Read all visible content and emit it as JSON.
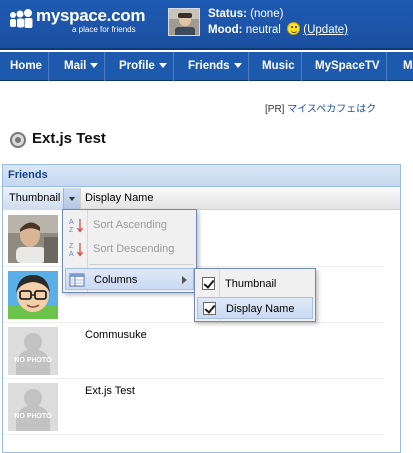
{
  "header": {
    "logo_text": "myspace.com",
    "tagline": "a place for friends",
    "status_label": "Status:",
    "status_value": "(none)",
    "mood_label": "Mood:",
    "mood_value": "neutral",
    "update_label": "(Update)"
  },
  "nav": {
    "items": [
      {
        "label": "Home"
      },
      {
        "label": "Mail"
      },
      {
        "label": "Profile"
      },
      {
        "label": "Friends"
      },
      {
        "label": "Music"
      },
      {
        "label": "MySpaceTV"
      },
      {
        "label": "M"
      }
    ]
  },
  "page": {
    "pr_prefix": "[PR]",
    "pr_text": "マイスペカフェはク",
    "app_title": "Ext.js Test"
  },
  "grid": {
    "title": "Friends",
    "columns": [
      "Thumbnail",
      "Display Name"
    ],
    "rows": [
      {
        "name": "",
        "thumb": "photo-1"
      },
      {
        "name": "",
        "thumb": "photo-2"
      },
      {
        "name": "Commusuke",
        "thumb": "no-photo"
      },
      {
        "name": "Ext.js Test",
        "thumb": "no-photo"
      }
    ],
    "no_photo_label": "NO PHOTO"
  },
  "column_menu": {
    "sort_asc": "Sort Ascending",
    "sort_desc": "Sort Descending",
    "columns": "Columns"
  },
  "columns_submenu": {
    "items": [
      {
        "label": "Thumbnail",
        "checked": true
      },
      {
        "label": "Display Name",
        "checked": true
      }
    ]
  },
  "colors": {
    "header_blue": "#1f5bb3",
    "panel_border": "#99bbe8",
    "panel_title": "#15428b"
  }
}
